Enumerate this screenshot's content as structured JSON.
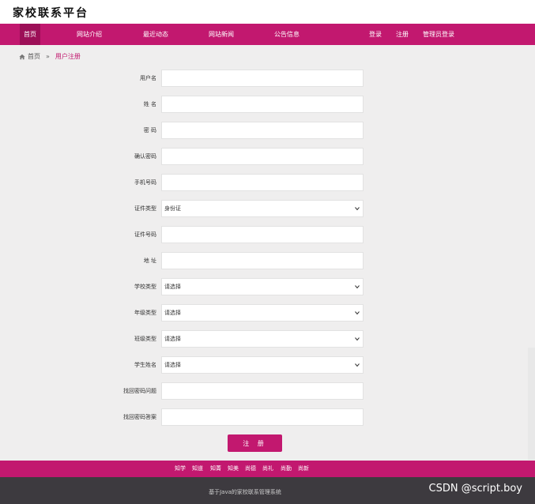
{
  "site": {
    "title": "家校联系平台"
  },
  "nav": {
    "items": [
      "首页",
      "网站介绍",
      "最近动态",
      "网站新闻",
      "公告信息"
    ],
    "login": "登录",
    "register": "注册",
    "admin_login": "管理员登录"
  },
  "breadcrumb": {
    "home": "首页",
    "separator": "»",
    "current": "用户注册"
  },
  "form": {
    "username": {
      "label": "用户名",
      "value": ""
    },
    "name": {
      "label": "姓 名",
      "value": ""
    },
    "password": {
      "label": "密 码",
      "value": ""
    },
    "confirm_password": {
      "label": "确认密码",
      "value": ""
    },
    "phone": {
      "label": "手机号码",
      "value": ""
    },
    "id_type": {
      "label": "证件类型",
      "selected": "身份证"
    },
    "id_number": {
      "label": "证件号码",
      "value": ""
    },
    "address": {
      "label": "地 址",
      "value": ""
    },
    "school_type": {
      "label": "学校类型",
      "selected": "请选择"
    },
    "grade_type": {
      "label": "年级类型",
      "selected": "请选择"
    },
    "class_type": {
      "label": "班级类型",
      "selected": "请选择"
    },
    "student_name": {
      "label": "学生姓名",
      "selected": "请选择"
    },
    "security_question": {
      "label": "找回密码问题",
      "value": ""
    },
    "security_answer": {
      "label": "找回密码答案",
      "value": ""
    },
    "submit_label": "注 册"
  },
  "footer": {
    "links": [
      "知学",
      "知道",
      "知菁",
      "知美",
      "尚德",
      "尚礼",
      "尚勤",
      "尚新"
    ],
    "text": "基于Java的家校联系管理系统",
    "watermark": "CSDN @script.boy"
  },
  "colors": {
    "accent": "#c2186f",
    "footer_dark": "#3d3a3f",
    "background": "#efeeee"
  }
}
